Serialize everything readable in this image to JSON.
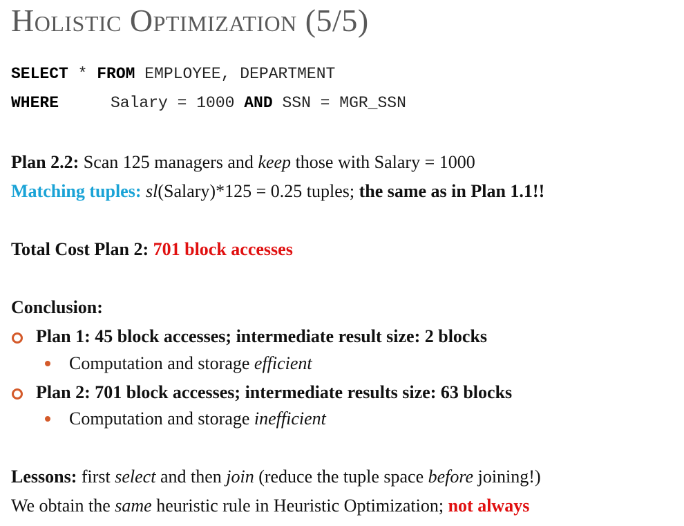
{
  "slide": {
    "title": "Holistic Optimization (5/5)"
  },
  "query": {
    "select_kw": "SELECT",
    "select_rest": " * ",
    "from_kw": "FROM",
    "from_rest": " EMPLOYEE, DEPARTMENT",
    "where_kw": "WHERE",
    "where_cond1": "Salary = 1000 ",
    "and_kw": "AND",
    "where_cond2": " SSN = MGR_SSN"
  },
  "plan22": {
    "label": "Plan 2.2:",
    "text1": " Scan 125 managers and ",
    "keep": "keep",
    "text2": " those with Salary = 1000"
  },
  "matching": {
    "label": "Matching tuples:",
    "sl": "sl",
    "text": "(Salary)*125 = 0.25 tuples; ",
    "bold": "the same as in Plan 1.1!!"
  },
  "total": {
    "label": "Total Cost Plan 2: ",
    "value": "701 block accesses"
  },
  "conclusion": {
    "heading": "Conclusion:",
    "items": [
      {
        "text": "Plan 1: 45 block accesses; intermediate result size: 2 blocks",
        "sub_prefix": "Computation and storage ",
        "sub_italic": "efficient"
      },
      {
        "text": "Plan 2: 701 block accesses; intermediate results size: 63 blocks",
        "sub_prefix": "Computation and storage ",
        "sub_italic": "inefficient"
      }
    ]
  },
  "lessons": {
    "label": "Lessons:",
    "t1": " first ",
    "select": "select",
    "t2": " and then ",
    "join": "join",
    "t3": " (reduce the tuple space ",
    "before": "before",
    "t4": " joining!)",
    "l2_t1": "We obtain the ",
    "same": "same",
    "l2_t2": " heuristic rule in Heuristic Optimization; ",
    "not_always": "not always"
  },
  "colors": {
    "accent_orange": "#d45a2a",
    "cyan": "#1aa3d6",
    "red": "#e01010",
    "title_gray": "#595959"
  }
}
